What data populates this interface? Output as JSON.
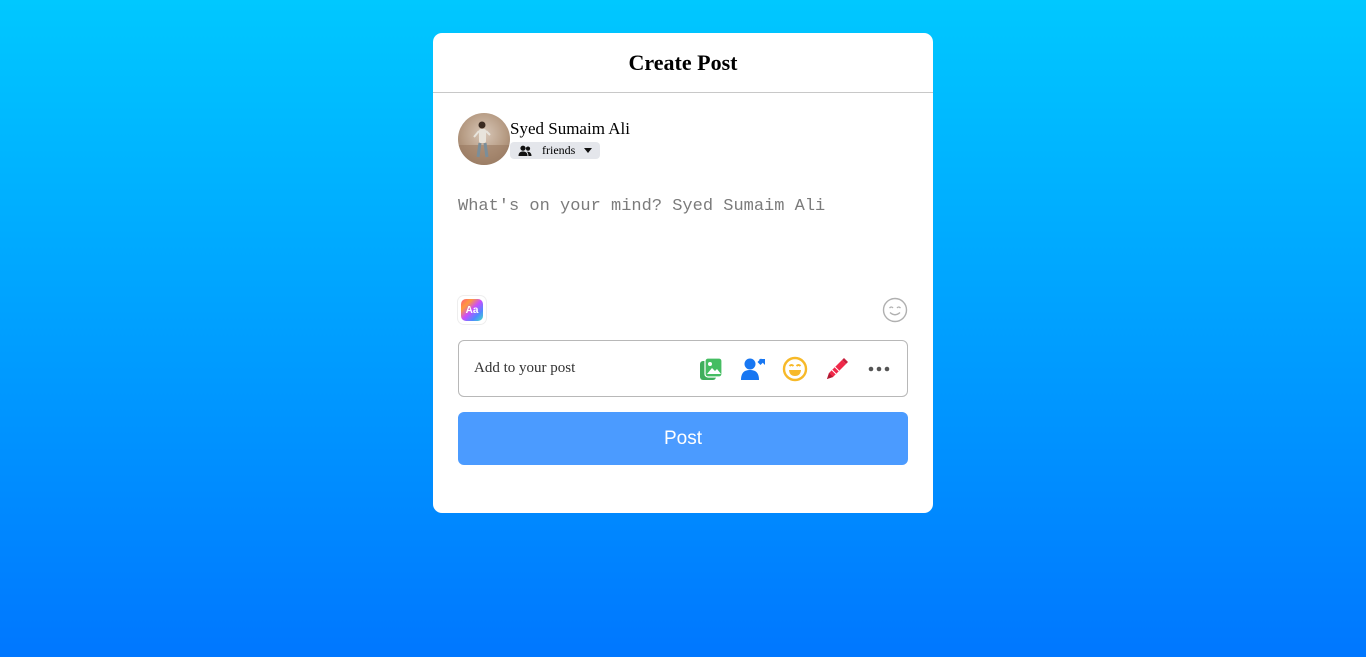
{
  "dialog": {
    "title": "Create Post"
  },
  "user": {
    "name": "Syed Sumaim Ali",
    "audience_label": "friends"
  },
  "composer": {
    "placeholder": "What's on your mind? Syed Sumaim Ali",
    "value": ""
  },
  "tools": {
    "background_icon_text": "Aa",
    "background_icon": "text-background-icon",
    "emoji_icon": "smiley-icon"
  },
  "add_to_post": {
    "label": "Add to your post",
    "icons": [
      "photo-video-icon",
      "tag-people-icon",
      "feeling-icon",
      "marker-icon",
      "more-icon"
    ]
  },
  "post_button": {
    "label": "Post"
  },
  "colors": {
    "background_top": "#00c8ff",
    "background_bottom": "#0077ff",
    "post_button": "#4b9bff",
    "photo_icon": "#45bd62",
    "tag_icon": "#1877f2",
    "feeling_icon": "#f7b928",
    "marker_icon": "#f02849"
  }
}
